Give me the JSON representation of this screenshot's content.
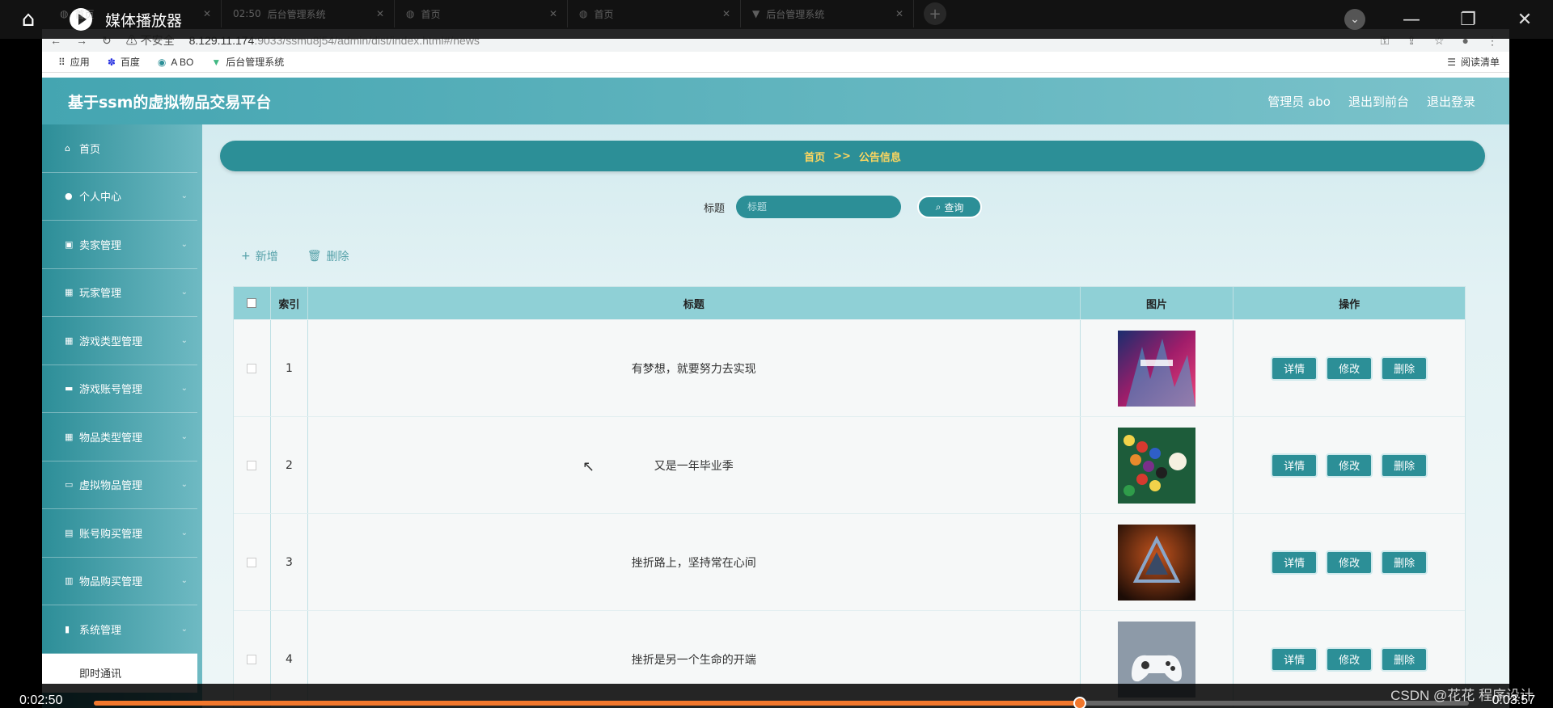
{
  "media_player": {
    "title": "媒体播放器",
    "time_current": "0:02:50",
    "time_total": "0:03:57",
    "progress_fraction": 0.717,
    "timer_badge": "02:50",
    "watermark": "CSDN @花花 程序设计"
  },
  "browser": {
    "tabs": [
      {
        "label": "首页"
      },
      {
        "label": "后台管理系统"
      },
      {
        "label": "首页"
      },
      {
        "label": "首页"
      },
      {
        "label": "后台管理系统"
      }
    ],
    "security": "不安全",
    "url_host": "8.129.11.174",
    "url_rest": ":9033/ssmu8j54/admin/dist/index.html#/news",
    "bookmarks": [
      {
        "icon": "apps-icon",
        "label": "应用"
      },
      {
        "icon": "baidu-icon",
        "label": "百度"
      },
      {
        "icon": "bookmark-icon",
        "label": "A BO"
      },
      {
        "icon": "vue-icon",
        "label": "后台管理系统"
      }
    ],
    "reading_list": "阅读清单"
  },
  "app": {
    "title": "基于ssm的虚拟物品交易平台",
    "nav": {
      "admin": "管理员 abo",
      "front": "退出到前台",
      "logout": "退出登录"
    },
    "sidebar": [
      {
        "icon": "home-icon",
        "label": "首页"
      },
      {
        "icon": "user-icon",
        "label": "个人中心"
      },
      {
        "icon": "chart-icon",
        "label": "卖家管理"
      },
      {
        "icon": "grid-icon",
        "label": "玩家管理"
      },
      {
        "icon": "grid-icon",
        "label": "游戏类型管理"
      },
      {
        "icon": "briefcase-icon",
        "label": "游戏账号管理"
      },
      {
        "icon": "grid-icon",
        "label": "物品类型管理"
      },
      {
        "icon": "monitor-icon",
        "label": "虚拟物品管理"
      },
      {
        "icon": "clipboard-icon",
        "label": "账号购买管理"
      },
      {
        "icon": "printer-icon",
        "label": "物品购买管理"
      },
      {
        "icon": "library-icon",
        "label": "系统管理"
      }
    ],
    "sidebar_open_sub": "即时通讯",
    "breadcrumb": {
      "home": "首页",
      "sep": ">>",
      "current": "公告信息"
    },
    "search": {
      "label": "标题",
      "placeholder": "标题",
      "button": "查询"
    },
    "actions": {
      "add": "新增",
      "delete": "删除"
    },
    "table": {
      "headers": {
        "index": "索引",
        "title": "标题",
        "image": "图片",
        "ops": "操作"
      },
      "op_labels": {
        "detail": "详情",
        "edit": "修改",
        "delete": "删除"
      },
      "rows": [
        {
          "index": "1",
          "title": "有梦想，就要努力去实现",
          "image": "match-day-poster"
        },
        {
          "index": "2",
          "title": "又是一年毕业季",
          "image": "billiard-balls"
        },
        {
          "index": "3",
          "title": "挫折路上，坚持常在心间",
          "image": "dark-triangle-logo"
        },
        {
          "index": "4",
          "title": "挫折是另一个生命的开端",
          "image": "game-controller"
        }
      ]
    }
  }
}
